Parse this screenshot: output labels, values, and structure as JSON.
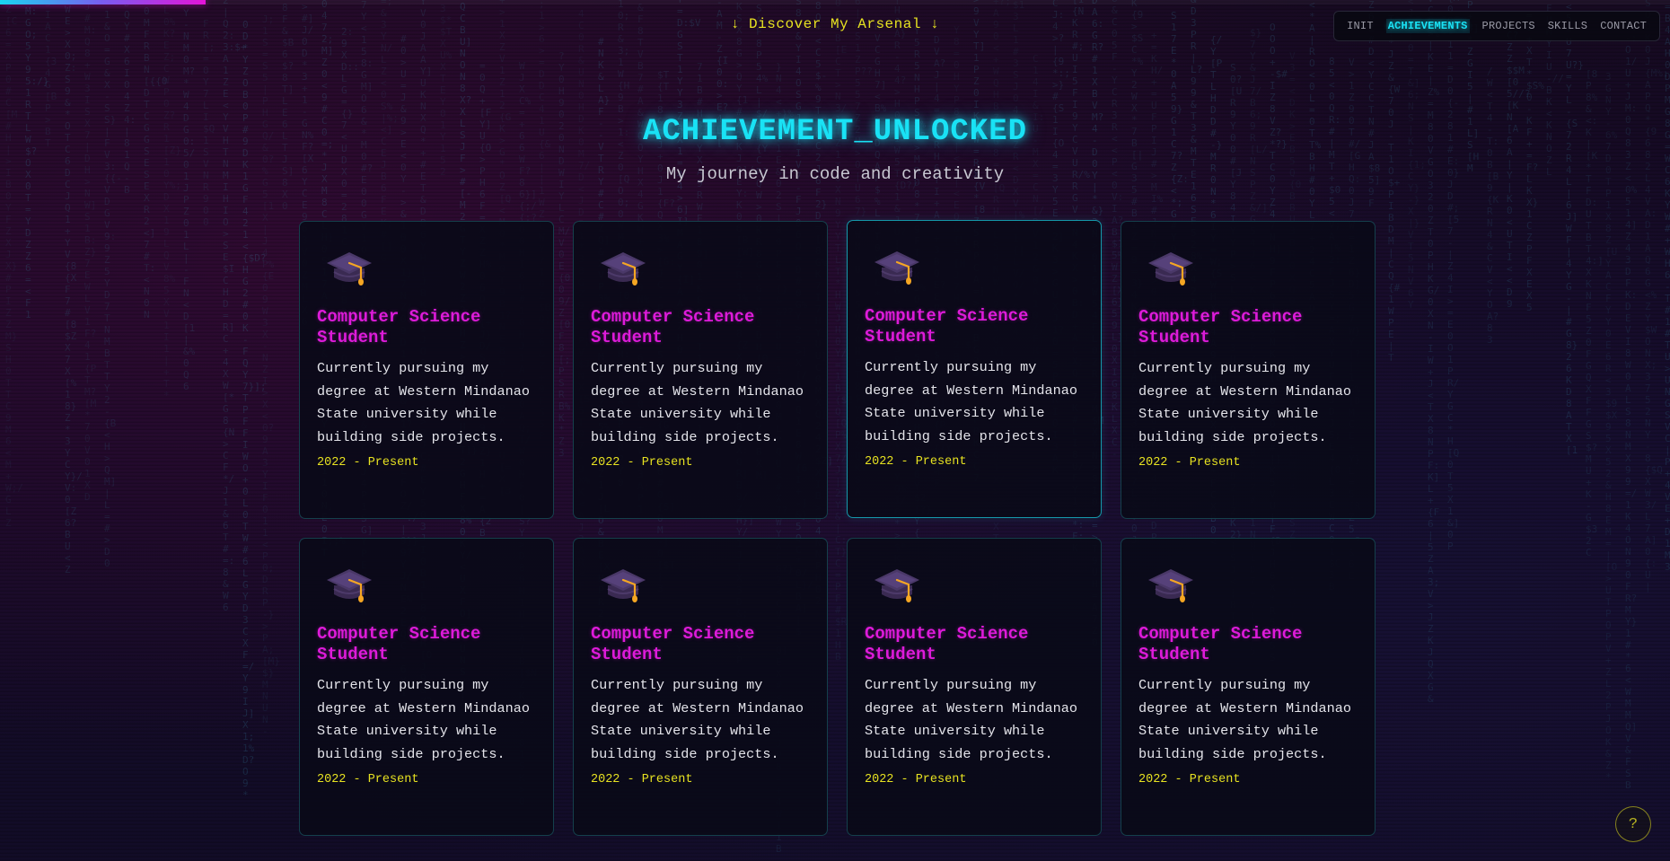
{
  "progress": {
    "fraction": 0.123
  },
  "header": {
    "discover_label": "↓ Discover My Arsenal ↓"
  },
  "nav": {
    "items": [
      {
        "label": "INIT",
        "active": false
      },
      {
        "label": "ACHIEVEMENTS",
        "active": true
      },
      {
        "label": "PROJECTS",
        "active": false
      },
      {
        "label": "SKILLS",
        "active": false
      },
      {
        "label": "CONTACT",
        "active": false
      }
    ]
  },
  "section": {
    "title": "ACHIEVEMENT_UNLOCKED",
    "subtitle": "My journey in code and creativity"
  },
  "cards": [
    {
      "icon": "graduation-cap-icon",
      "title": "Computer Science Student",
      "description": "Currently pursuing my degree at Western Mindanao State university while building side projects.",
      "date": "2022 - Present"
    },
    {
      "icon": "graduation-cap-icon",
      "title": "Computer Science Student",
      "description": "Currently pursuing my degree at Western Mindanao State university while building side projects.",
      "date": "2022 - Present"
    },
    {
      "icon": "graduation-cap-icon",
      "title": "Computer Science Student",
      "description": "Currently pursuing my degree at Western Mindanao State university while building side projects.",
      "date": "2022 - Present"
    },
    {
      "icon": "graduation-cap-icon",
      "title": "Computer Science Student",
      "description": "Currently pursuing my degree at Western Mindanao State university while building side projects.",
      "date": "2022 - Present"
    },
    {
      "icon": "graduation-cap-icon",
      "title": "Computer Science Student",
      "description": "Currently pursuing my degree at Western Mindanao State university while building side projects.",
      "date": "2022 - Present"
    },
    {
      "icon": "graduation-cap-icon",
      "title": "Computer Science Student",
      "description": "Currently pursuing my degree at Western Mindanao State university while building side projects.",
      "date": "2022 - Present"
    },
    {
      "icon": "graduation-cap-icon",
      "title": "Computer Science Student",
      "description": "Currently pursuing my degree at Western Mindanao State university while building side projects.",
      "date": "2022 - Present"
    },
    {
      "icon": "graduation-cap-icon",
      "title": "Computer Science Student",
      "description": "Currently pursuing my degree at Western Mindanao State university while building side projects.",
      "date": "2022 - Present"
    }
  ],
  "help_button": {
    "label": "?"
  },
  "colors": {
    "accent_cyan": "#19e2f5",
    "accent_magenta": "#dd1bd9",
    "accent_yellow": "#e7e221",
    "background": "#12081f"
  }
}
